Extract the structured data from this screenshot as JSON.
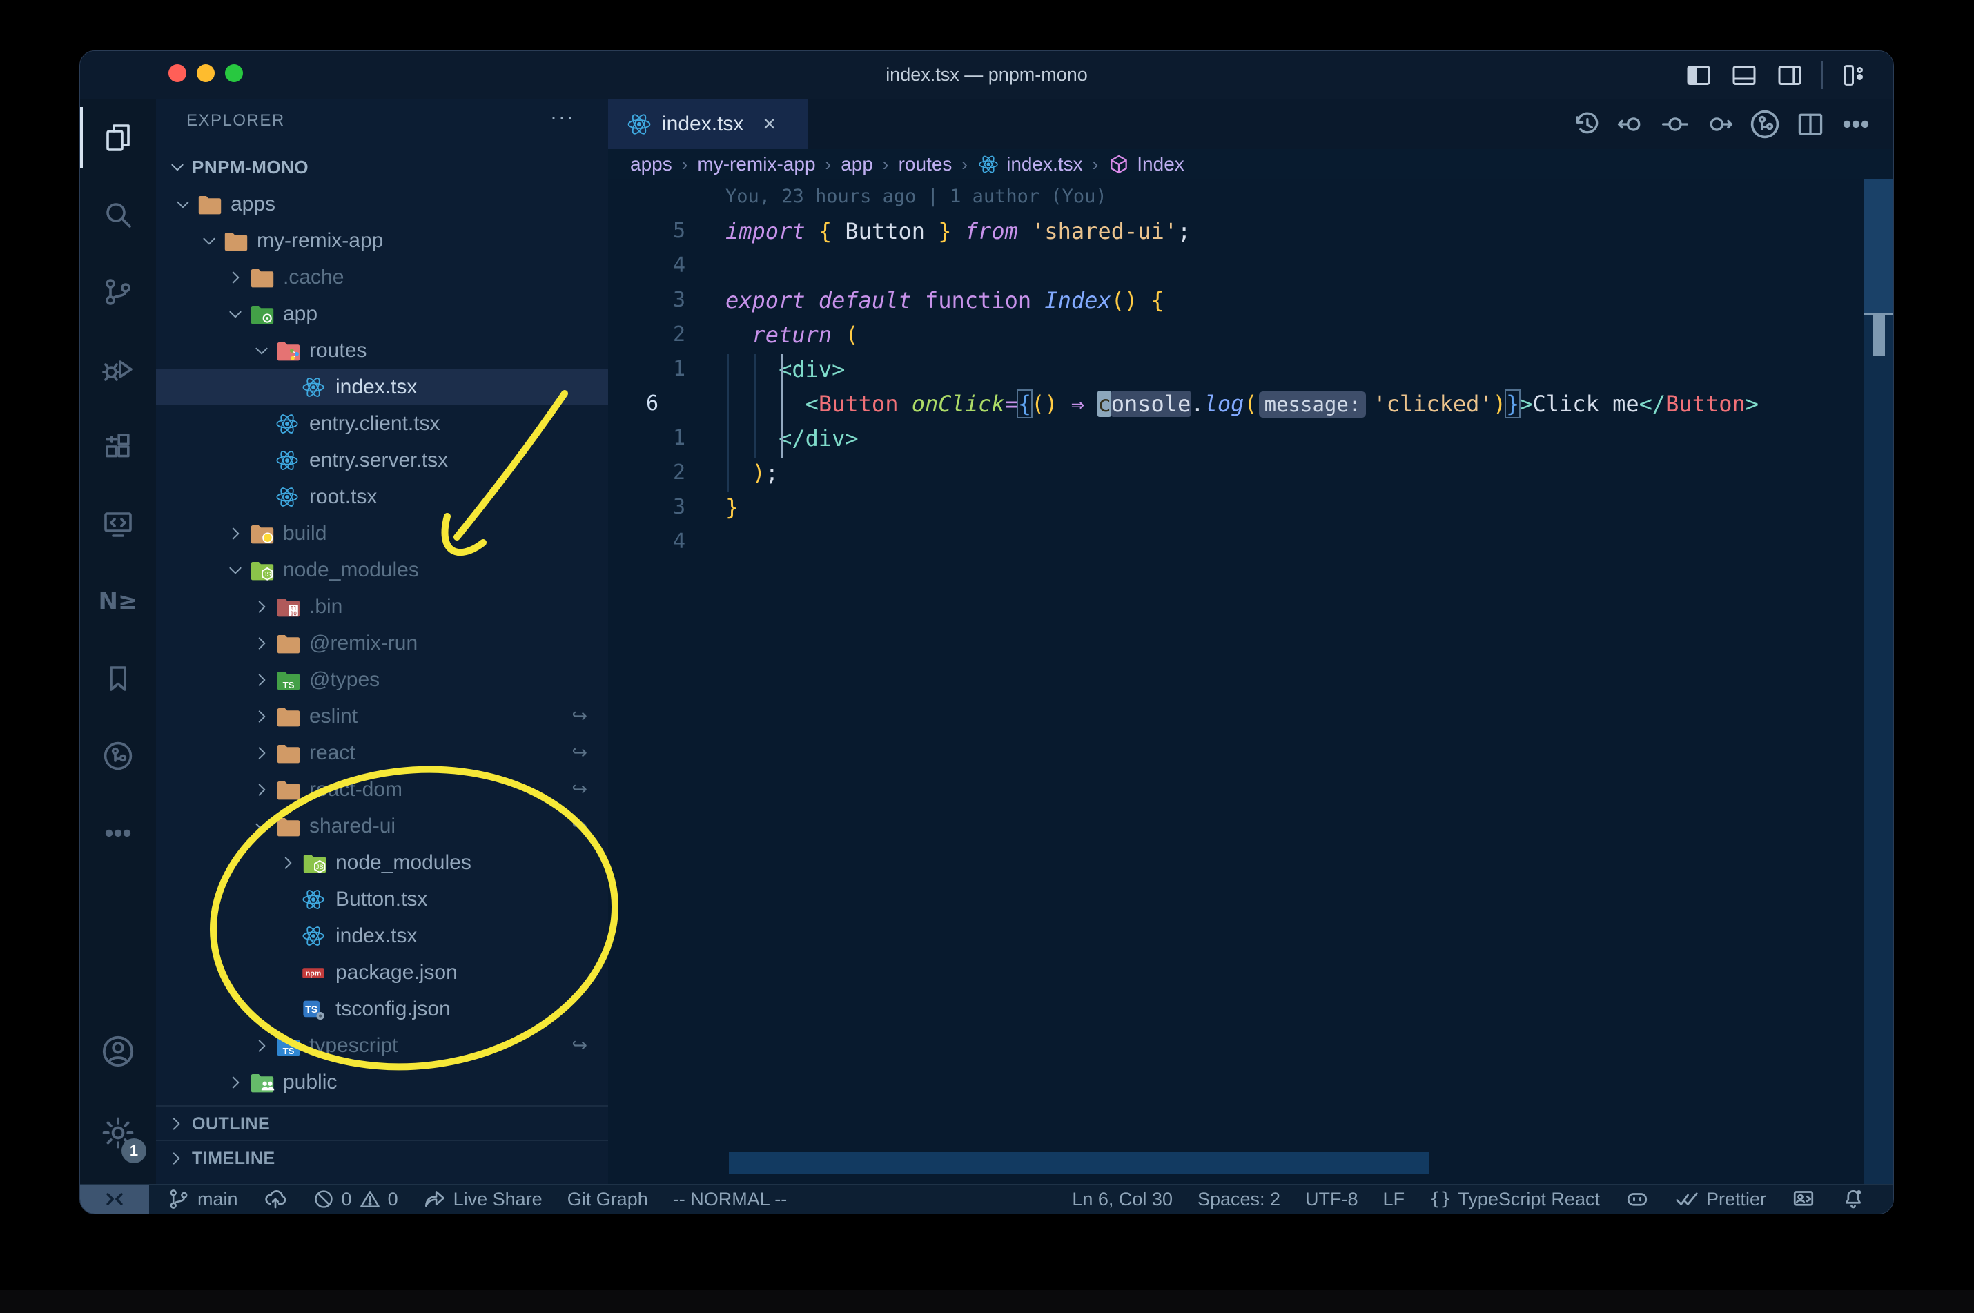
{
  "window": {
    "title": "index.tsx — pnpm-mono"
  },
  "colors": {
    "annotation_yellow": "#f6e838",
    "editor_bg": "#081a2e",
    "sidebar_bg": "#0c1d33",
    "tab_active_bg": "#16294a",
    "keyword_pink": "#c792ea",
    "string_tan": "#ecc48d",
    "tag_coral": "#f07178",
    "angle_teal": "#7fdbca",
    "attr_green": "#addb67",
    "brace_gold": "#ffcb45",
    "fn_blue": "#82aaff"
  },
  "titlebar_icons": [
    {
      "name": "layout-sidebar-left"
    },
    {
      "name": "layout-panel-bottom"
    },
    {
      "name": "layout-sidebar-right"
    },
    {
      "name": "layout-customize"
    }
  ],
  "activity_bar": {
    "top": [
      {
        "name": "files",
        "active": true
      },
      {
        "name": "search"
      },
      {
        "name": "source-control"
      },
      {
        "name": "run-debug"
      },
      {
        "name": "extensions"
      },
      {
        "name": "remote-explorer"
      },
      {
        "name": "neovim"
      },
      {
        "name": "bookmarks"
      },
      {
        "name": "gitlens"
      },
      {
        "name": "more"
      }
    ],
    "bottom": [
      {
        "name": "account"
      },
      {
        "name": "settings",
        "badge": "1"
      }
    ]
  },
  "explorer": {
    "header": "EXPLORER",
    "header_actions": "···",
    "root": "PNPM-MONO",
    "sections": [
      "OUTLINE",
      "TIMELINE"
    ],
    "tree": [
      {
        "label": "apps",
        "level": 1,
        "icon": "folder-tan",
        "chevron": "down"
      },
      {
        "label": "my-remix-app",
        "level": 2,
        "icon": "folder-tan",
        "chevron": "down"
      },
      {
        "label": ".cache",
        "level": 3,
        "icon": "folder-tan",
        "chevron": "right",
        "dim": true
      },
      {
        "label": "app",
        "level": 3,
        "icon": "folder-app",
        "chevron": "down"
      },
      {
        "label": "routes",
        "level": 4,
        "icon": "folder-routes",
        "chevron": "down"
      },
      {
        "label": "index.tsx",
        "level": 5,
        "icon": "react",
        "selected": true
      },
      {
        "label": "entry.client.tsx",
        "level": 4,
        "icon": "react"
      },
      {
        "label": "entry.server.tsx",
        "level": 4,
        "icon": "react"
      },
      {
        "label": "root.tsx",
        "level": 4,
        "icon": "react"
      },
      {
        "label": "build",
        "level": 3,
        "icon": "folder-build",
        "chevron": "right",
        "dim": true
      },
      {
        "label": "node_modules",
        "level": 3,
        "icon": "folder-node",
        "chevron": "down",
        "dim": true
      },
      {
        "label": ".bin",
        "level": 4,
        "icon": "folder-bin",
        "chevron": "right",
        "dim": true
      },
      {
        "label": "@remix-run",
        "level": 4,
        "icon": "folder-tan",
        "chevron": "right",
        "dim": true
      },
      {
        "label": "@types",
        "level": 4,
        "icon": "folder-types",
        "chevron": "right",
        "dim": true
      },
      {
        "label": "eslint",
        "level": 4,
        "icon": "folder-tan",
        "chevron": "right",
        "dim": true,
        "symlink": true
      },
      {
        "label": "react",
        "level": 4,
        "icon": "folder-tan",
        "chevron": "right",
        "dim": true,
        "symlink": true
      },
      {
        "label": "react-dom",
        "level": 4,
        "icon": "folder-tan",
        "chevron": "right",
        "dim": true,
        "symlink": true
      },
      {
        "label": "shared-ui",
        "level": 4,
        "icon": "folder-tan",
        "chevron": "down",
        "dim": true,
        "symlink": true
      },
      {
        "label": "node_modules",
        "level": 5,
        "icon": "folder-node",
        "chevron": "right"
      },
      {
        "label": "Button.tsx",
        "level": 5,
        "icon": "react"
      },
      {
        "label": "index.tsx",
        "level": 5,
        "icon": "react"
      },
      {
        "label": "package.json",
        "level": 5,
        "icon": "npm"
      },
      {
        "label": "tsconfig.json",
        "level": 5,
        "icon": "tsconfig"
      },
      {
        "label": "typescript",
        "level": 4,
        "icon": "folder-ts",
        "chevron": "right",
        "dim": true,
        "symlink": true
      },
      {
        "label": "public",
        "level": 3,
        "icon": "folder-public",
        "chevron": "right"
      }
    ]
  },
  "tabs": [
    {
      "label": "index.tsx",
      "icon": "react",
      "close": "×",
      "active": true
    }
  ],
  "editor_toolbar": [
    {
      "name": "history"
    },
    {
      "name": "prev-change"
    },
    {
      "name": "change"
    },
    {
      "name": "next-change"
    },
    {
      "name": "branch-circle"
    },
    {
      "name": "split-editor"
    },
    {
      "name": "more-dots"
    }
  ],
  "breadcrumbs": {
    "separator": "›",
    "items": [
      {
        "label": "apps"
      },
      {
        "label": "my-remix-app"
      },
      {
        "label": "app"
      },
      {
        "label": "routes"
      },
      {
        "label": "index.tsx",
        "icon": "react"
      },
      {
        "label": "Index",
        "icon": "symbol-namespace"
      }
    ]
  },
  "code": {
    "blame": "You, 23 hours ago | 1 author (You)",
    "lines": [
      {
        "gutter": "5",
        "tokens": [
          {
            "t": "import",
            "c": "kw"
          },
          {
            "t": " ",
            "c": "pl"
          },
          {
            "t": "{",
            "c": "br"
          },
          {
            "t": " Button ",
            "c": "pl"
          },
          {
            "t": "}",
            "c": "br"
          },
          {
            "t": " ",
            "c": "pl"
          },
          {
            "t": "from",
            "c": "kw"
          },
          {
            "t": " ",
            "c": "pl"
          },
          {
            "t": "'shared-ui'",
            "c": "str"
          },
          {
            "t": ";",
            "c": "pl"
          }
        ]
      },
      {
        "gutter": "4",
        "tokens": []
      },
      {
        "gutter": "3",
        "tokens": [
          {
            "t": "export",
            "c": "kw"
          },
          {
            "t": " ",
            "c": "pl"
          },
          {
            "t": "default",
            "c": "kw"
          },
          {
            "t": " ",
            "c": "pl"
          },
          {
            "t": "function",
            "c": "kw2"
          },
          {
            "t": " ",
            "c": "pl"
          },
          {
            "t": "Index",
            "c": "fn"
          },
          {
            "t": "(",
            "c": "br"
          },
          {
            "t": ")",
            "c": "br"
          },
          {
            "t": " ",
            "c": "pl"
          },
          {
            "t": "{",
            "c": "br"
          }
        ]
      },
      {
        "gutter": "2",
        "tokens": [
          {
            "t": "  ",
            "c": "pl"
          },
          {
            "t": "return",
            "c": "kw"
          },
          {
            "t": " ",
            "c": "pl"
          },
          {
            "t": "(",
            "c": "br"
          }
        ]
      },
      {
        "gutter": "1",
        "tokens": [
          {
            "t": "    ",
            "c": "pl"
          },
          {
            "t": "<div>",
            "c": "ang"
          }
        ]
      },
      {
        "gutter": "6",
        "current": true,
        "tokens": [
          {
            "t": "      ",
            "c": "pl"
          },
          {
            "t": "<",
            "c": "ang"
          },
          {
            "t": "Button",
            "c": "tag"
          },
          {
            "t": " ",
            "c": "pl"
          },
          {
            "t": "onClick",
            "c": "attr"
          },
          {
            "t": "=",
            "c": "arr"
          },
          {
            "t": "{",
            "c": "bb"
          },
          {
            "t": "(",
            "c": "br"
          },
          {
            "t": ")",
            "c": "br"
          },
          {
            "t": " ",
            "c": "pl"
          },
          {
            "t": "⇒",
            "c": "arr"
          },
          {
            "t": " ",
            "c": "pl"
          },
          {
            "t": "c",
            "c": "cur"
          },
          {
            "t": "onsole",
            "c": "whl"
          },
          {
            "t": ".",
            "c": "pl"
          },
          {
            "t": "log",
            "c": "fn"
          },
          {
            "t": "(",
            "c": "br"
          },
          {
            "t": "message:",
            "c": "inlay"
          },
          {
            "t": "'clicked'",
            "c": "str"
          },
          {
            "t": ")",
            "c": "br"
          },
          {
            "t": "}",
            "c": "bb"
          },
          {
            "t": ">",
            "c": "ang"
          },
          {
            "t": "Click me",
            "c": "pl"
          },
          {
            "t": "</",
            "c": "ang"
          },
          {
            "t": "Button",
            "c": "tag"
          },
          {
            "t": ">",
            "c": "ang"
          }
        ]
      },
      {
        "gutter": "1",
        "tokens": [
          {
            "t": "    ",
            "c": "pl"
          },
          {
            "t": "</div>",
            "c": "ang"
          }
        ]
      },
      {
        "gutter": "2",
        "tokens": [
          {
            "t": "  ",
            "c": "pl"
          },
          {
            "t": ")",
            "c": "br"
          },
          {
            "t": ";",
            "c": "pl"
          }
        ]
      },
      {
        "gutter": "3",
        "tokens": [
          {
            "t": "}",
            "c": "br"
          }
        ]
      },
      {
        "gutter": "4",
        "tokens": []
      }
    ]
  },
  "status_bar": {
    "left": [
      {
        "icon": "git-branch",
        "label": "main",
        "name": "branch-indicator"
      },
      {
        "icon": "cloud-upload",
        "label": "",
        "name": "publish-changes"
      },
      {
        "icon": "error-circle",
        "label": "0",
        "icon2": "warning-triangle",
        "label2": "0",
        "name": "problems"
      },
      {
        "icon": "live-share",
        "label": "Live Share",
        "name": "live-share"
      },
      {
        "label": "Git Graph",
        "name": "git-graph"
      },
      {
        "label": "-- NORMAL --",
        "name": "vim-mode"
      }
    ],
    "right": [
      {
        "label": "Ln 6, Col 30",
        "name": "cursor-position"
      },
      {
        "label": "Spaces: 2",
        "name": "indentation"
      },
      {
        "label": "UTF-8",
        "name": "encoding"
      },
      {
        "label": "LF",
        "name": "eol"
      },
      {
        "icon": "braces",
        "label": "TypeScript React",
        "name": "language-mode"
      },
      {
        "icon": "copilot",
        "label": "",
        "name": "copilot"
      },
      {
        "icon": "check-double",
        "label": "Prettier",
        "name": "prettier"
      },
      {
        "icon": "feedback",
        "label": "",
        "name": "feedback"
      },
      {
        "icon": "bell",
        "label": "",
        "name": "notifications"
      }
    ]
  }
}
